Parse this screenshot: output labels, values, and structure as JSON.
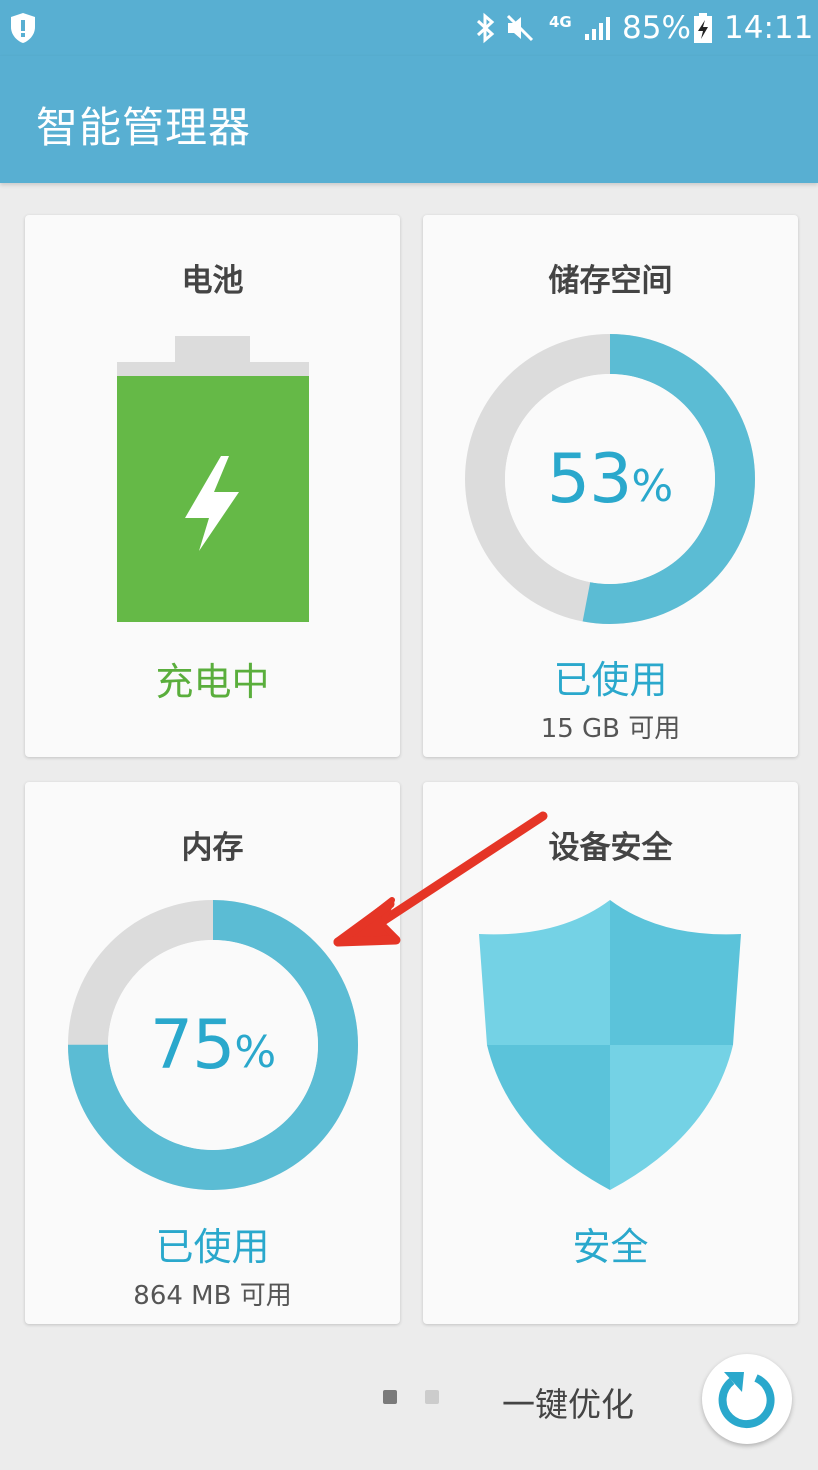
{
  "status_bar": {
    "network": "4G",
    "battery_percent": "85%",
    "time": "14:11"
  },
  "app_bar": {
    "title": "智能管理器"
  },
  "cards": {
    "battery": {
      "title": "电池",
      "status": "充电中",
      "level_fraction": 1.0
    },
    "storage": {
      "title": "储存空间",
      "percent": "53",
      "percent_sign": "%",
      "status": "已使用",
      "sub": "15 GB 可用",
      "used_fraction": 0.53
    },
    "memory": {
      "title": "内存",
      "percent": "75",
      "percent_sign": "%",
      "status": "已使用",
      "sub": "864 MB 可用",
      "used_fraction": 0.75
    },
    "security": {
      "title": "设备安全",
      "status": "安全"
    }
  },
  "bottom_bar": {
    "optimize_label": "一键优化",
    "page_indicator": {
      "pages": 2,
      "active": 1
    }
  },
  "colors": {
    "accent": "#58afd2",
    "ring": "#5bbcd4",
    "ring_track": "#dcdcdc",
    "battery_green": "#65b947",
    "percent_text": "#2aa8cc",
    "status_blue": "#2aa8cc",
    "status_green": "#5aae3c",
    "arrow_red": "#e53526"
  },
  "icons": [
    "shield-alert-icon",
    "bluetooth-icon",
    "mute-icon",
    "signal-icon",
    "battery-charging-icon",
    "lightning-icon",
    "security-shield-icon",
    "refresh-icon",
    "annotation-arrow"
  ]
}
